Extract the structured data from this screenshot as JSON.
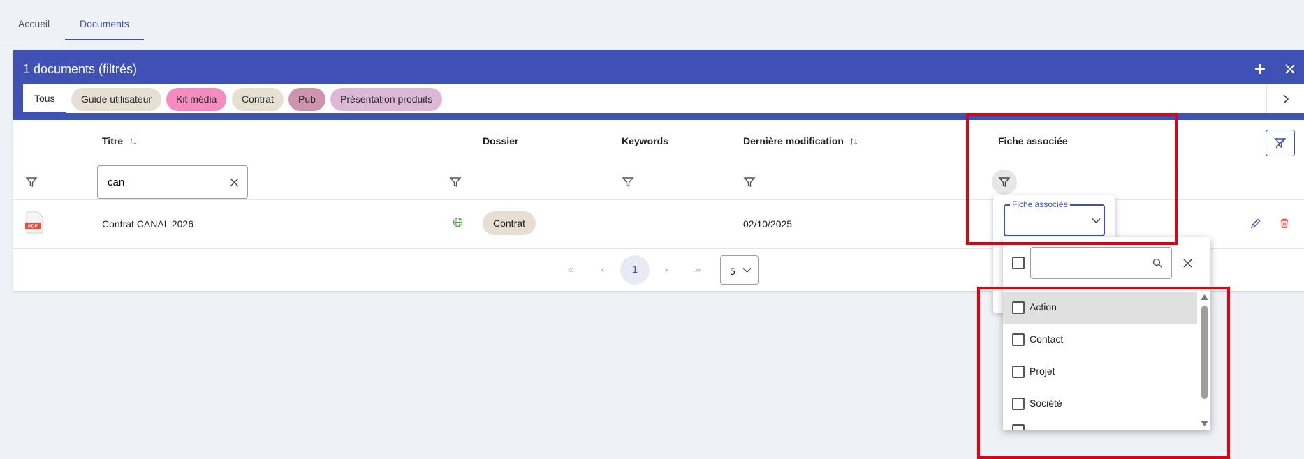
{
  "tabs": {
    "home": "Accueil",
    "documents": "Documents"
  },
  "card": {
    "title": "1 documents (filtrés)",
    "add_icon": "plus-icon",
    "close_icon": "close-icon"
  },
  "chips": {
    "all": "Tous",
    "items": [
      {
        "label": "Guide utilisateur",
        "color": "#e6dfd2"
      },
      {
        "label": "Kit média",
        "color": "#f58bbf"
      },
      {
        "label": "Contrat",
        "color": "#e6dfd2"
      },
      {
        "label": "Pub",
        "color": "#cf94ad"
      },
      {
        "label": "Présentation produits",
        "color": "#dcb8d6"
      }
    ]
  },
  "table": {
    "headers": {
      "title": "Titre",
      "folder": "Dossier",
      "keywords": "Keywords",
      "modified": "Dernière modification",
      "linked": "Fiche associée"
    },
    "filters": {
      "title_value": "can"
    },
    "rows": [
      {
        "file_type": "PDF",
        "title": "Contrat CANAL 2026",
        "folder_tag": "Contrat",
        "modified": "02/10/2025"
      }
    ]
  },
  "pagination": {
    "current": "1",
    "page_size": "5"
  },
  "linked_filter": {
    "label": "Fiche associée",
    "options": [
      "Action",
      "Contact",
      "Projet",
      "Société"
    ]
  },
  "colors": {
    "primary": "#3f51b5",
    "highlight_border": "#e3000f",
    "delete": "#e53935"
  }
}
